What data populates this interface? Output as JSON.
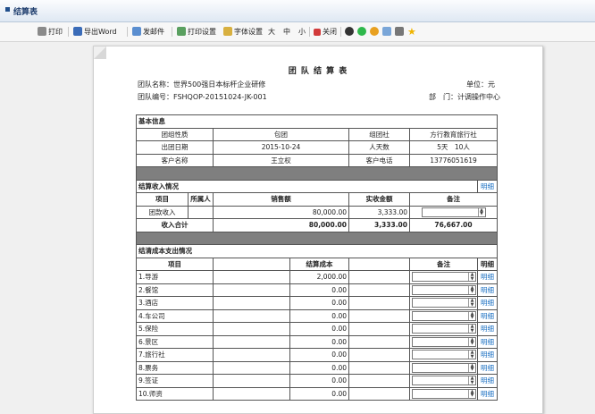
{
  "window": {
    "title": "结算表"
  },
  "toolbar": {
    "print": "打印",
    "export_word": "导出Word",
    "send_mail": "发邮件",
    "print_settings": "打印设置",
    "font_settings": "字体设置",
    "font_large": "大",
    "font_medium": "中",
    "font_small": "小",
    "close": "关闭"
  },
  "doc": {
    "title": "团 队 结 算 表",
    "team_name_label": "团队名称：世界500强日本标杆企业研修",
    "unit_label": "单位：元",
    "team_no_label": "团队编号：FSHQOP-20151024-JK-001",
    "dept_label": "部　门：计调操作中心"
  },
  "basic": {
    "header": "基本信息",
    "group_type_label": "团组性质",
    "group_type": "包团",
    "agency_label": "组团社",
    "agency": "方行教育旅行社",
    "date_label": "出团日期",
    "date": "2015-10-24",
    "people_label": "人天数",
    "people": "5天　10人",
    "customer_label": "客户名称",
    "customer": "王立权",
    "phone_label": "客户电话",
    "phone": "13776051619"
  },
  "income": {
    "header": "结算收入情况",
    "detail": "明细",
    "col_item": "项目",
    "col_owner": "所属人",
    "col_sales": "销售额",
    "col_received": "实收金额",
    "col_note": "备注",
    "row_item": "团款收入",
    "row_sales": "80,000.00",
    "row_received": "3,333.00",
    "total_label": "收入合计",
    "total_sales": "80,000.00",
    "total_received": "3,333.00",
    "total_balance": "76,667.00"
  },
  "cost": {
    "header": "结清成本支出情况",
    "col_item": "项目",
    "col_cost": "结算成本",
    "col_note": "备注",
    "col_detail": "明细",
    "rows": [
      {
        "name": "1.导游",
        "amount": "2,000.00",
        "detail": "明细"
      },
      {
        "name": "2.餐馆",
        "amount": "0.00",
        "detail": "明细"
      },
      {
        "name": "3.酒店",
        "amount": "0.00",
        "detail": "明细"
      },
      {
        "name": "4.车公司",
        "amount": "0.00",
        "detail": "明细"
      },
      {
        "name": "5.保险",
        "amount": "0.00",
        "detail": "明细"
      },
      {
        "name": "6.景区",
        "amount": "0.00",
        "detail": "明细"
      },
      {
        "name": "7.旅行社",
        "amount": "0.00",
        "detail": "明细"
      },
      {
        "name": "8.票务",
        "amount": "0.00",
        "detail": "明细"
      },
      {
        "name": "9.签证",
        "amount": "0.00",
        "detail": "明细"
      },
      {
        "name": "10.师资",
        "amount": "0.00",
        "detail": "明细"
      }
    ]
  }
}
